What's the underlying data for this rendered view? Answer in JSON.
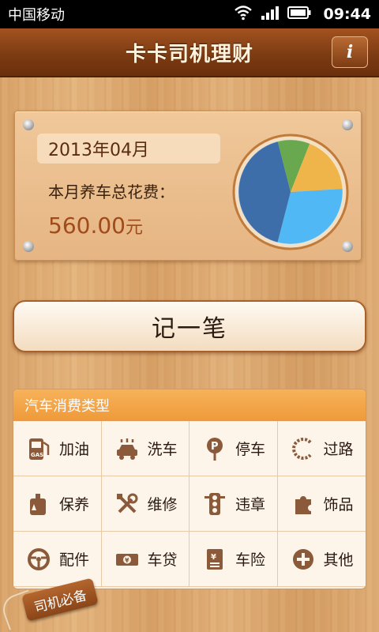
{
  "status_bar": {
    "carrier": "中国移动",
    "time": "09:44",
    "icons": [
      "wifi-icon",
      "signal-icon",
      "battery-icon"
    ]
  },
  "header": {
    "title": "卡卡司机理财",
    "info_label": "i"
  },
  "summary": {
    "month": "2013年04月",
    "label": "本月养车总花费：",
    "amount": "560.00",
    "unit": "元",
    "pie_slices": [
      {
        "value": 0.1,
        "color": "#6aa84f"
      },
      {
        "value": 0.18,
        "color": "#f0b54a"
      },
      {
        "value": 0.3,
        "color": "#4fb8f5"
      },
      {
        "value": 0.42,
        "color": "#3d6eaa"
      }
    ]
  },
  "record_button": "记一笔",
  "categories": {
    "title": "汽车消费类型",
    "items": [
      {
        "label": "加油",
        "icon": "gas-pump-icon"
      },
      {
        "label": "洗车",
        "icon": "car-wash-icon"
      },
      {
        "label": "停车",
        "icon": "parking-icon"
      },
      {
        "label": "过路",
        "icon": "toll-road-icon"
      },
      {
        "label": "保养",
        "icon": "oil-can-icon"
      },
      {
        "label": "维修",
        "icon": "wrench-icon"
      },
      {
        "label": "违章",
        "icon": "traffic-light-icon"
      },
      {
        "label": "饰品",
        "icon": "puzzle-icon"
      },
      {
        "label": "配件",
        "icon": "steering-wheel-icon"
      },
      {
        "label": "车贷",
        "icon": "money-icon"
      },
      {
        "label": "车险",
        "icon": "insurance-icon"
      },
      {
        "label": "其他",
        "icon": "plus-icon"
      }
    ]
  },
  "tag_label": "司机必备",
  "colors": {
    "accent": "#ef9a3a",
    "header": "#7a3a12",
    "amount": "#a14a1a"
  }
}
